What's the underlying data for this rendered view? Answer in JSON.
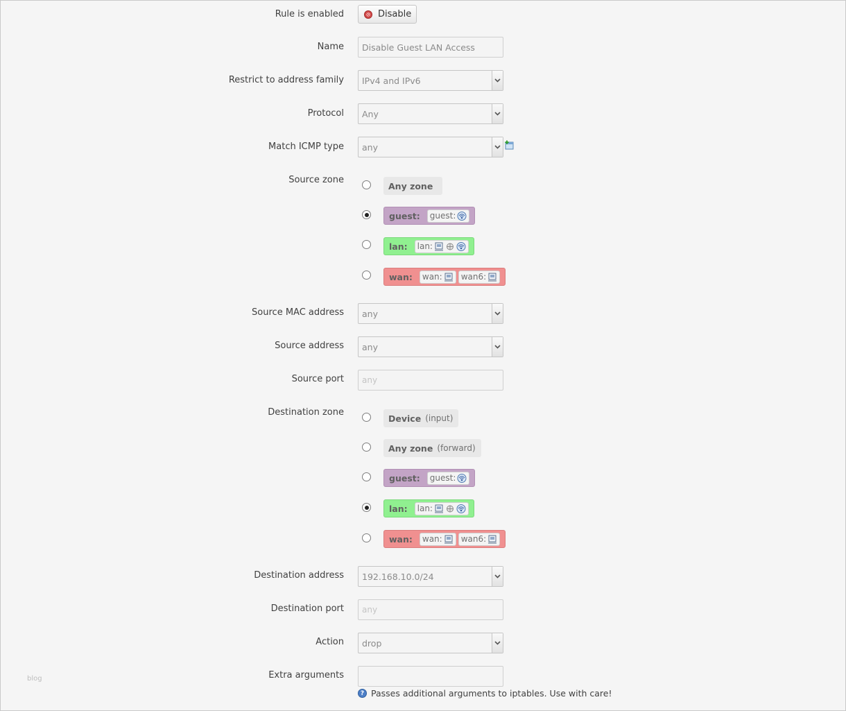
{
  "rule_enabled": {
    "label": "Rule is enabled",
    "button": "Disable"
  },
  "name": {
    "label": "Name",
    "value": "Disable Guest LAN Access"
  },
  "address_family": {
    "label": "Restrict to address family",
    "value": "IPv4 and IPv6"
  },
  "protocol": {
    "label": "Protocol",
    "value": "Any"
  },
  "icmp_type": {
    "label": "Match ICMP type",
    "value": "any"
  },
  "source_zone": {
    "label": "Source zone",
    "options": [
      {
        "name": "Any zone",
        "selected": false
      },
      {
        "name": "guest:",
        "selected": true,
        "devices": [
          "guest:"
        ]
      },
      {
        "name": "lan:",
        "selected": false,
        "devices": [
          "lan:"
        ]
      },
      {
        "name": "wan:",
        "selected": false,
        "devices": [
          "wan:",
          "wan6:"
        ]
      }
    ]
  },
  "source_mac": {
    "label": "Source MAC address",
    "value": "any"
  },
  "source_address": {
    "label": "Source address",
    "value": "any"
  },
  "source_port": {
    "label": "Source port",
    "placeholder": "any"
  },
  "dest_zone": {
    "label": "Destination zone",
    "options": [
      {
        "name": "Device",
        "suffix": "(input)",
        "selected": false
      },
      {
        "name": "Any zone",
        "suffix": "(forward)",
        "selected": false
      },
      {
        "name": "guest:",
        "selected": false,
        "devices": [
          "guest:"
        ]
      },
      {
        "name": "lan:",
        "selected": true,
        "devices": [
          "lan:"
        ]
      },
      {
        "name": "wan:",
        "selected": false,
        "devices": [
          "wan:",
          "wan6:"
        ]
      }
    ]
  },
  "dest_address": {
    "label": "Destination address",
    "value": "192.168.10.0/24"
  },
  "dest_port": {
    "label": "Destination port",
    "placeholder": "any"
  },
  "action": {
    "label": "Action",
    "value": "drop"
  },
  "extra_args": {
    "label": "Extra arguments",
    "value": "",
    "hint": "Passes additional arguments to iptables. Use with care!"
  },
  "watermark": "blog",
  "colors": {
    "guest": "#c3a4c6",
    "lan": "#90f090",
    "wan": "#f09090",
    "background": "#f5f5f5"
  },
  "icons": [
    "disable-icon",
    "add-icon",
    "wifi-icon",
    "ethernet-icon",
    "bridge-icon",
    "help-icon",
    "chevron-down-icon"
  ]
}
